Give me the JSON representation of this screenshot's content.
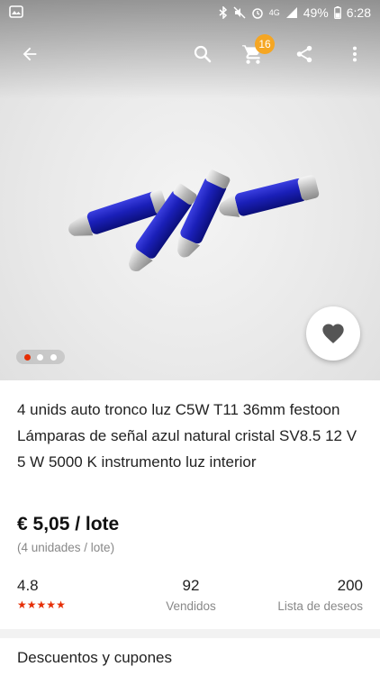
{
  "status_bar": {
    "battery": "49%",
    "time": "6:28",
    "network": "4G"
  },
  "toolbar": {
    "back_icon": "arrow-left-icon",
    "search_icon": "search-icon",
    "cart_icon": "cart-icon",
    "cart_count": "16",
    "share_icon": "share-icon",
    "more_icon": "more-vertical-icon"
  },
  "gallery": {
    "total_images": 3,
    "active_index": 0
  },
  "product": {
    "title": "4 unids auto tronco luz C5W T11 36mm festoon Lámparas de señal azul natural cristal SV8.5 12 V 5 W 5000 K instrumento luz interior",
    "price": "€ 5,05 / lote",
    "unit_note": "(4 unidades / lote)"
  },
  "stats": {
    "rating": "4.8",
    "rating_stars": 5,
    "sold_value": "92",
    "sold_label": "Vendidos",
    "wishlist_value": "200",
    "wishlist_label": "Lista de deseos"
  },
  "sections": {
    "discounts_title": "Descuentos y cupones"
  },
  "colors": {
    "accent": "#e62e04",
    "badge": "#f5a623"
  }
}
